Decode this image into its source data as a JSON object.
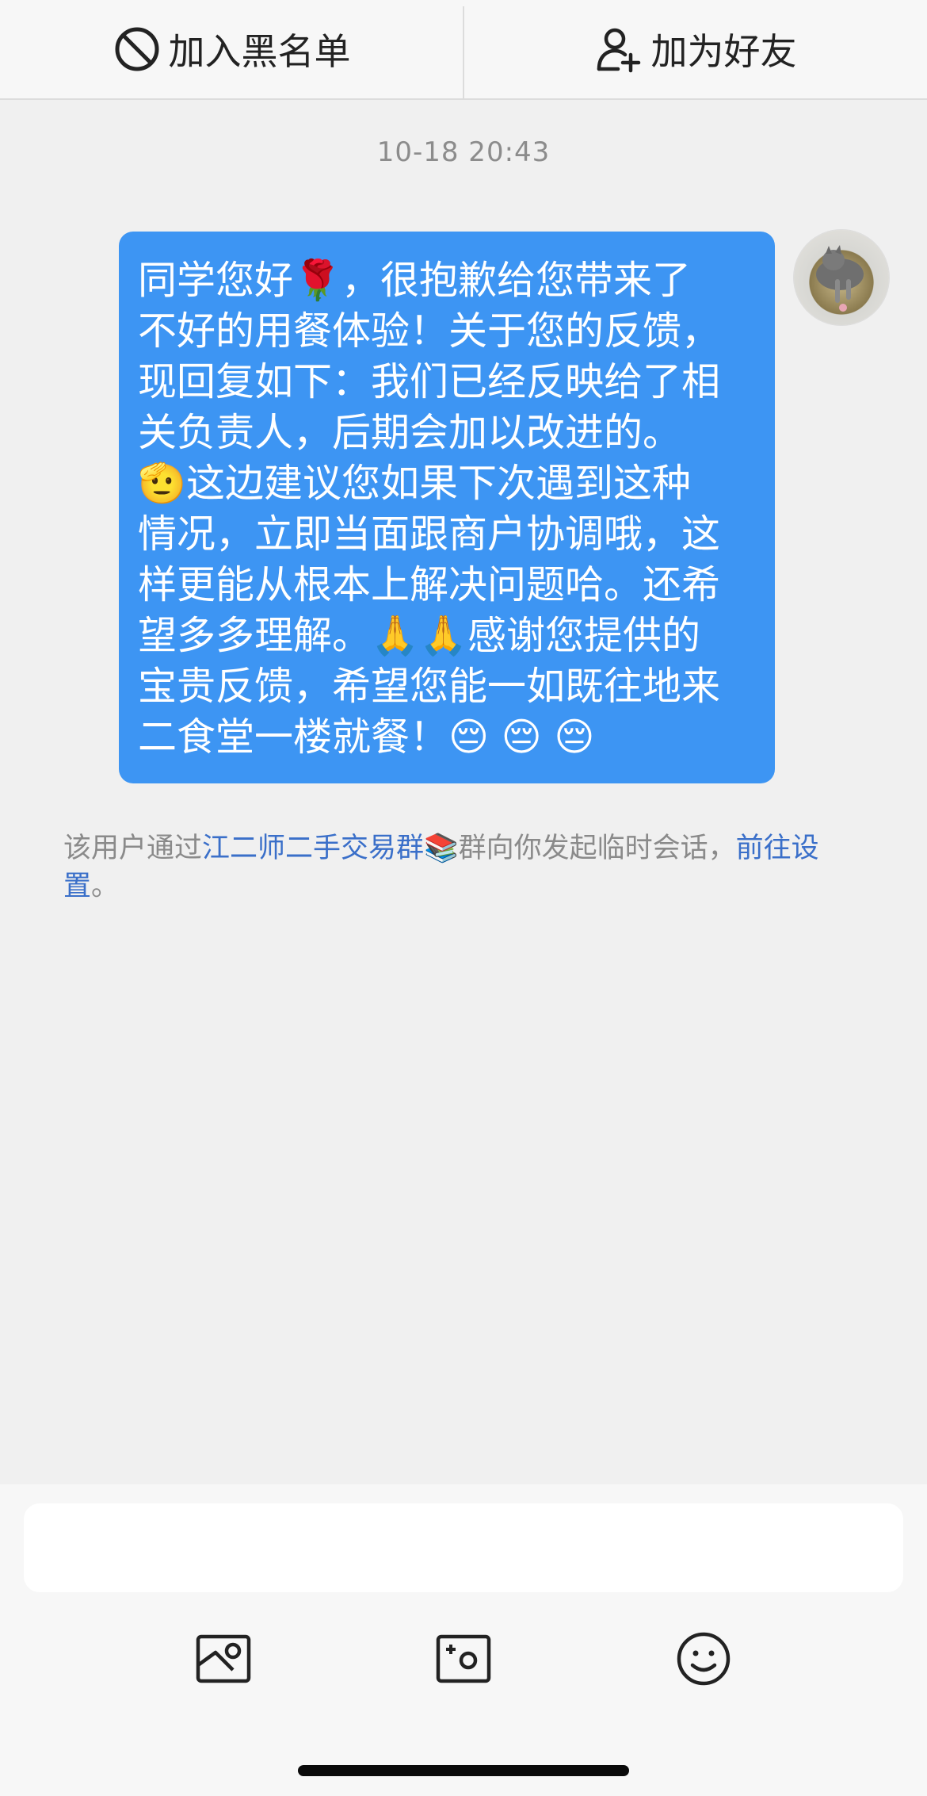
{
  "topbar": {
    "block_label": "加入黑名单",
    "block_icon": "block-icon",
    "add_friend_label": "加为好友",
    "add_friend_icon": "add-user-icon"
  },
  "chat": {
    "timestamp": "10-18 20:43",
    "message": {
      "lines": [
        "同学您好🌹，很抱歉给您带来了",
        "不好的用餐体验！关于您的反馈，",
        "现回复如下：我们已经反映给了相",
        "关负责人，后期会加以改进的。",
        "🫡这边建议您如果下次遇到这种",
        "情况，立即当面跟商户协调哦，这",
        "样更能从根本上解决问题哈。还希",
        "望多多理解。🙏🙏感谢您提供的",
        "宝贵反馈，希望您能一如既往地来",
        "二食堂一楼就餐！😔 😔 😔"
      ],
      "bubble_color": "#3d95f3"
    },
    "notice": {
      "prefix": "该用户通过",
      "group_name": "江二师二手交易群📚",
      "middle": "群向你发起临时会话，",
      "settings_link": "前往设置",
      "suffix": "。"
    }
  },
  "input_bar": {
    "placeholder": "",
    "tools": [
      "image-icon",
      "camera-icon",
      "emoji-icon"
    ]
  }
}
